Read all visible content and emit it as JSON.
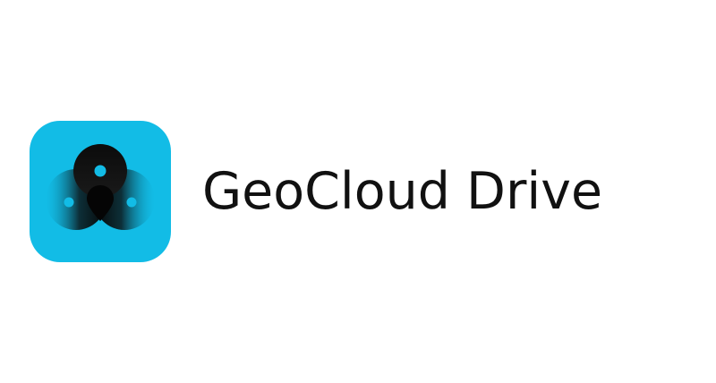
{
  "brand": {
    "name": "GeoCloud Drive",
    "icon": "geocloud-logo-icon",
    "colors": {
      "icon_background": "#12BCE6",
      "mark_dark": "#0A0A0A",
      "mark_mid": "#1B4A55",
      "wordmark": "#111111"
    }
  }
}
